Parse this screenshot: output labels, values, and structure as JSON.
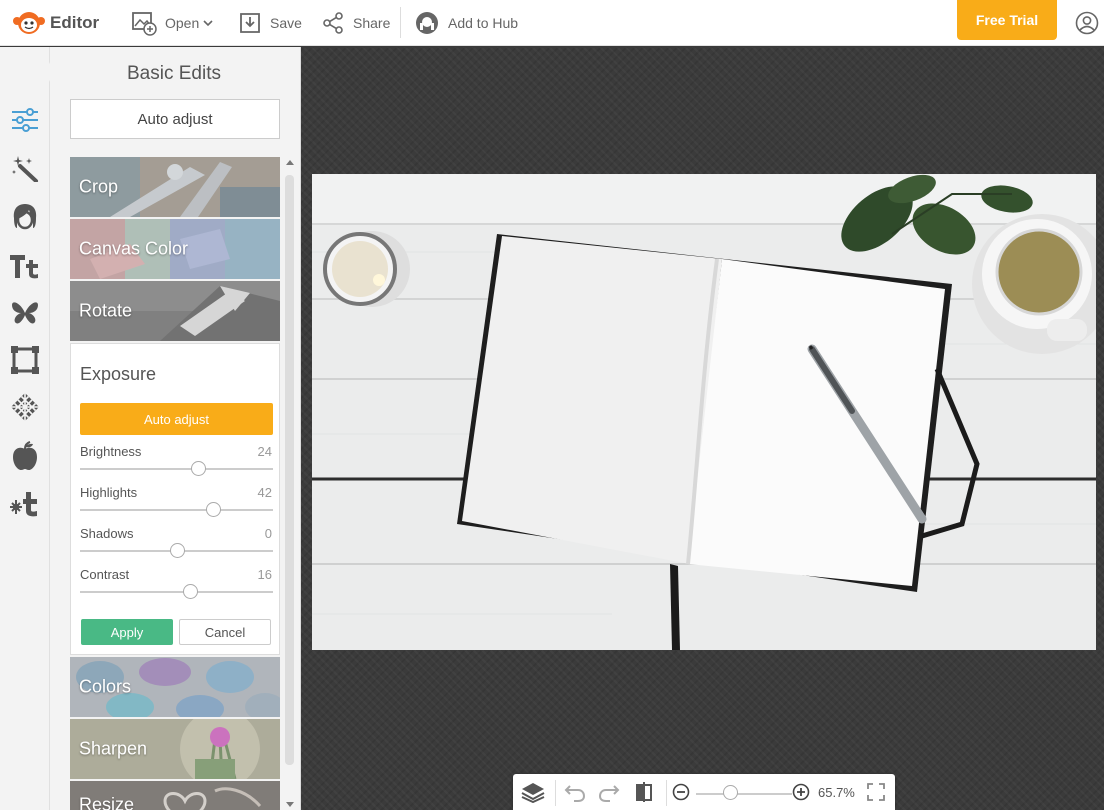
{
  "app": {
    "title": "Editor"
  },
  "toolbar": {
    "open_label": "Open",
    "save_label": "Save",
    "share_label": "Share",
    "hub_label": "Add to Hub",
    "free_trial_label": "Free Trial"
  },
  "rail": {
    "icons": [
      "sliders-icon",
      "magic-wand-icon",
      "face-icon",
      "text-icon",
      "butterfly-icon",
      "frame-icon",
      "texture-icon",
      "apple-icon",
      "design-icon"
    ],
    "active": "sliders-icon"
  },
  "panel": {
    "title": "Basic Edits",
    "auto_adjust_label": "Auto adjust",
    "tiles_top": [
      {
        "label": "Crop"
      },
      {
        "label": "Canvas Color"
      },
      {
        "label": "Rotate"
      }
    ],
    "exposure": {
      "title": "Exposure",
      "auto_adjust_label": "Auto adjust",
      "sliders": [
        {
          "label": "Brightness",
          "value": "24",
          "fraction": 0.61
        },
        {
          "label": "Highlights",
          "value": "42",
          "fraction": 0.69
        },
        {
          "label": "Shadows",
          "value": "0",
          "fraction": 0.5
        },
        {
          "label": "Contrast",
          "value": "16",
          "fraction": 0.57
        }
      ],
      "apply_label": "Apply",
      "cancel_label": "Cancel"
    },
    "tiles_bottom": [
      {
        "label": "Colors"
      },
      {
        "label": "Sharpen"
      },
      {
        "label": "Resize"
      }
    ]
  },
  "zoom": {
    "value": "65.7%",
    "fraction": 0.36
  },
  "colors": {
    "accent": "#f9ac18",
    "apply": "#49b985",
    "rail_active": "#4a9fd4"
  }
}
